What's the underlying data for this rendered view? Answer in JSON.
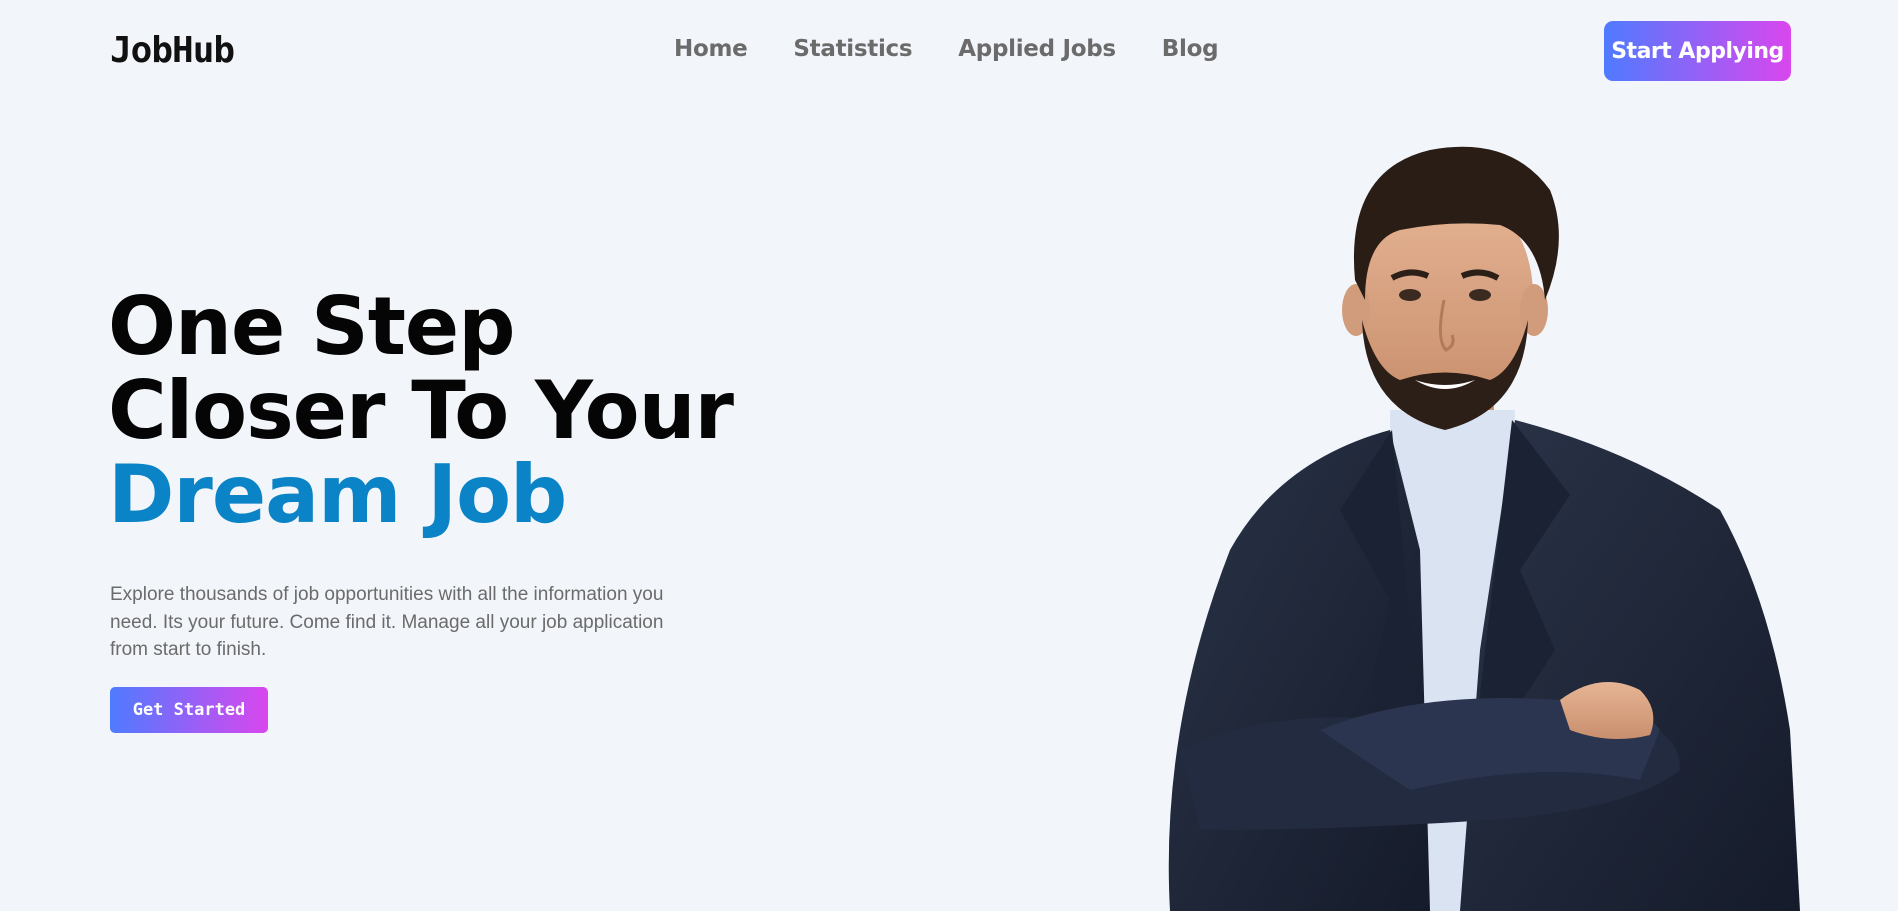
{
  "header": {
    "logo": "JobHub",
    "nav": [
      "Home",
      "Statistics",
      "Applied Jobs",
      "Blog"
    ],
    "cta_label": "Start Applying"
  },
  "hero": {
    "title_line1": "One Step",
    "title_line2": "Closer To Your",
    "title_accent": "Dream Job",
    "description": "Explore thousands of job opportunities with all the information you need. Its your future. Come find it. Manage all your job application from start to finish.",
    "cta_label": "Get Started"
  },
  "colors": {
    "background": "#f2f5fa",
    "accent_blue": "#0a84c6",
    "gradient_start": "#4f7bff",
    "gradient_end": "#d947ee"
  }
}
